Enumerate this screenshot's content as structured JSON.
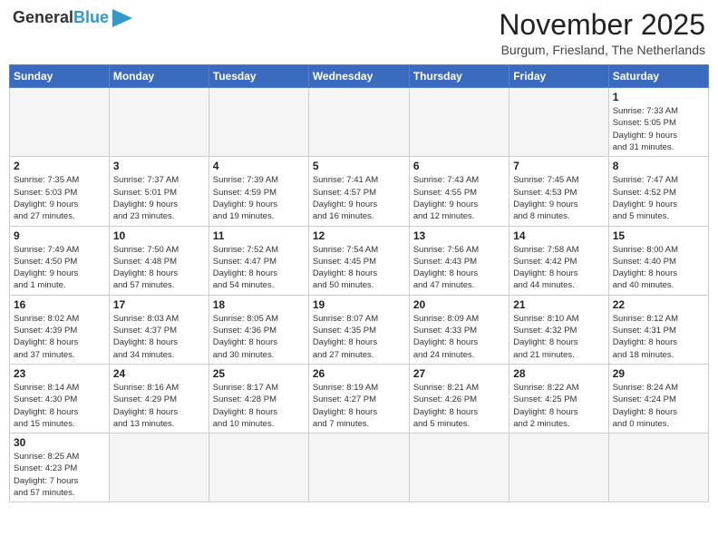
{
  "header": {
    "logo_general": "General",
    "logo_blue": "Blue",
    "month_title": "November 2025",
    "location": "Burgum, Friesland, The Netherlands"
  },
  "weekdays": [
    "Sunday",
    "Monday",
    "Tuesday",
    "Wednesday",
    "Thursday",
    "Friday",
    "Saturday"
  ],
  "weeks": [
    [
      {
        "day": "",
        "info": "",
        "empty": true
      },
      {
        "day": "",
        "info": "",
        "empty": true
      },
      {
        "day": "",
        "info": "",
        "empty": true
      },
      {
        "day": "",
        "info": "",
        "empty": true
      },
      {
        "day": "",
        "info": "",
        "empty": true
      },
      {
        "day": "",
        "info": "",
        "empty": true
      },
      {
        "day": "1",
        "info": "Sunrise: 7:33 AM\nSunset: 5:05 PM\nDaylight: 9 hours\nand 31 minutes."
      }
    ],
    [
      {
        "day": "2",
        "info": "Sunrise: 7:35 AM\nSunset: 5:03 PM\nDaylight: 9 hours\nand 27 minutes."
      },
      {
        "day": "3",
        "info": "Sunrise: 7:37 AM\nSunset: 5:01 PM\nDaylight: 9 hours\nand 23 minutes."
      },
      {
        "day": "4",
        "info": "Sunrise: 7:39 AM\nSunset: 4:59 PM\nDaylight: 9 hours\nand 19 minutes."
      },
      {
        "day": "5",
        "info": "Sunrise: 7:41 AM\nSunset: 4:57 PM\nDaylight: 9 hours\nand 16 minutes."
      },
      {
        "day": "6",
        "info": "Sunrise: 7:43 AM\nSunset: 4:55 PM\nDaylight: 9 hours\nand 12 minutes."
      },
      {
        "day": "7",
        "info": "Sunrise: 7:45 AM\nSunset: 4:53 PM\nDaylight: 9 hours\nand 8 minutes."
      },
      {
        "day": "8",
        "info": "Sunrise: 7:47 AM\nSunset: 4:52 PM\nDaylight: 9 hours\nand 5 minutes."
      }
    ],
    [
      {
        "day": "9",
        "info": "Sunrise: 7:49 AM\nSunset: 4:50 PM\nDaylight: 9 hours\nand 1 minute."
      },
      {
        "day": "10",
        "info": "Sunrise: 7:50 AM\nSunset: 4:48 PM\nDaylight: 8 hours\nand 57 minutes."
      },
      {
        "day": "11",
        "info": "Sunrise: 7:52 AM\nSunset: 4:47 PM\nDaylight: 8 hours\nand 54 minutes."
      },
      {
        "day": "12",
        "info": "Sunrise: 7:54 AM\nSunset: 4:45 PM\nDaylight: 8 hours\nand 50 minutes."
      },
      {
        "day": "13",
        "info": "Sunrise: 7:56 AM\nSunset: 4:43 PM\nDaylight: 8 hours\nand 47 minutes."
      },
      {
        "day": "14",
        "info": "Sunrise: 7:58 AM\nSunset: 4:42 PM\nDaylight: 8 hours\nand 44 minutes."
      },
      {
        "day": "15",
        "info": "Sunrise: 8:00 AM\nSunset: 4:40 PM\nDaylight: 8 hours\nand 40 minutes."
      }
    ],
    [
      {
        "day": "16",
        "info": "Sunrise: 8:02 AM\nSunset: 4:39 PM\nDaylight: 8 hours\nand 37 minutes."
      },
      {
        "day": "17",
        "info": "Sunrise: 8:03 AM\nSunset: 4:37 PM\nDaylight: 8 hours\nand 34 minutes."
      },
      {
        "day": "18",
        "info": "Sunrise: 8:05 AM\nSunset: 4:36 PM\nDaylight: 8 hours\nand 30 minutes."
      },
      {
        "day": "19",
        "info": "Sunrise: 8:07 AM\nSunset: 4:35 PM\nDaylight: 8 hours\nand 27 minutes."
      },
      {
        "day": "20",
        "info": "Sunrise: 8:09 AM\nSunset: 4:33 PM\nDaylight: 8 hours\nand 24 minutes."
      },
      {
        "day": "21",
        "info": "Sunrise: 8:10 AM\nSunset: 4:32 PM\nDaylight: 8 hours\nand 21 minutes."
      },
      {
        "day": "22",
        "info": "Sunrise: 8:12 AM\nSunset: 4:31 PM\nDaylight: 8 hours\nand 18 minutes."
      }
    ],
    [
      {
        "day": "23",
        "info": "Sunrise: 8:14 AM\nSunset: 4:30 PM\nDaylight: 8 hours\nand 15 minutes."
      },
      {
        "day": "24",
        "info": "Sunrise: 8:16 AM\nSunset: 4:29 PM\nDaylight: 8 hours\nand 13 minutes."
      },
      {
        "day": "25",
        "info": "Sunrise: 8:17 AM\nSunset: 4:28 PM\nDaylight: 8 hours\nand 10 minutes."
      },
      {
        "day": "26",
        "info": "Sunrise: 8:19 AM\nSunset: 4:27 PM\nDaylight: 8 hours\nand 7 minutes."
      },
      {
        "day": "27",
        "info": "Sunrise: 8:21 AM\nSunset: 4:26 PM\nDaylight: 8 hours\nand 5 minutes."
      },
      {
        "day": "28",
        "info": "Sunrise: 8:22 AM\nSunset: 4:25 PM\nDaylight: 8 hours\nand 2 minutes."
      },
      {
        "day": "29",
        "info": "Sunrise: 8:24 AM\nSunset: 4:24 PM\nDaylight: 8 hours\nand 0 minutes."
      }
    ],
    [
      {
        "day": "30",
        "info": "Sunrise: 8:25 AM\nSunset: 4:23 PM\nDaylight: 7 hours\nand 57 minutes."
      },
      {
        "day": "",
        "info": "",
        "empty": true
      },
      {
        "day": "",
        "info": "",
        "empty": true
      },
      {
        "day": "",
        "info": "",
        "empty": true
      },
      {
        "day": "",
        "info": "",
        "empty": true
      },
      {
        "day": "",
        "info": "",
        "empty": true
      },
      {
        "day": "",
        "info": "",
        "empty": true
      }
    ]
  ]
}
